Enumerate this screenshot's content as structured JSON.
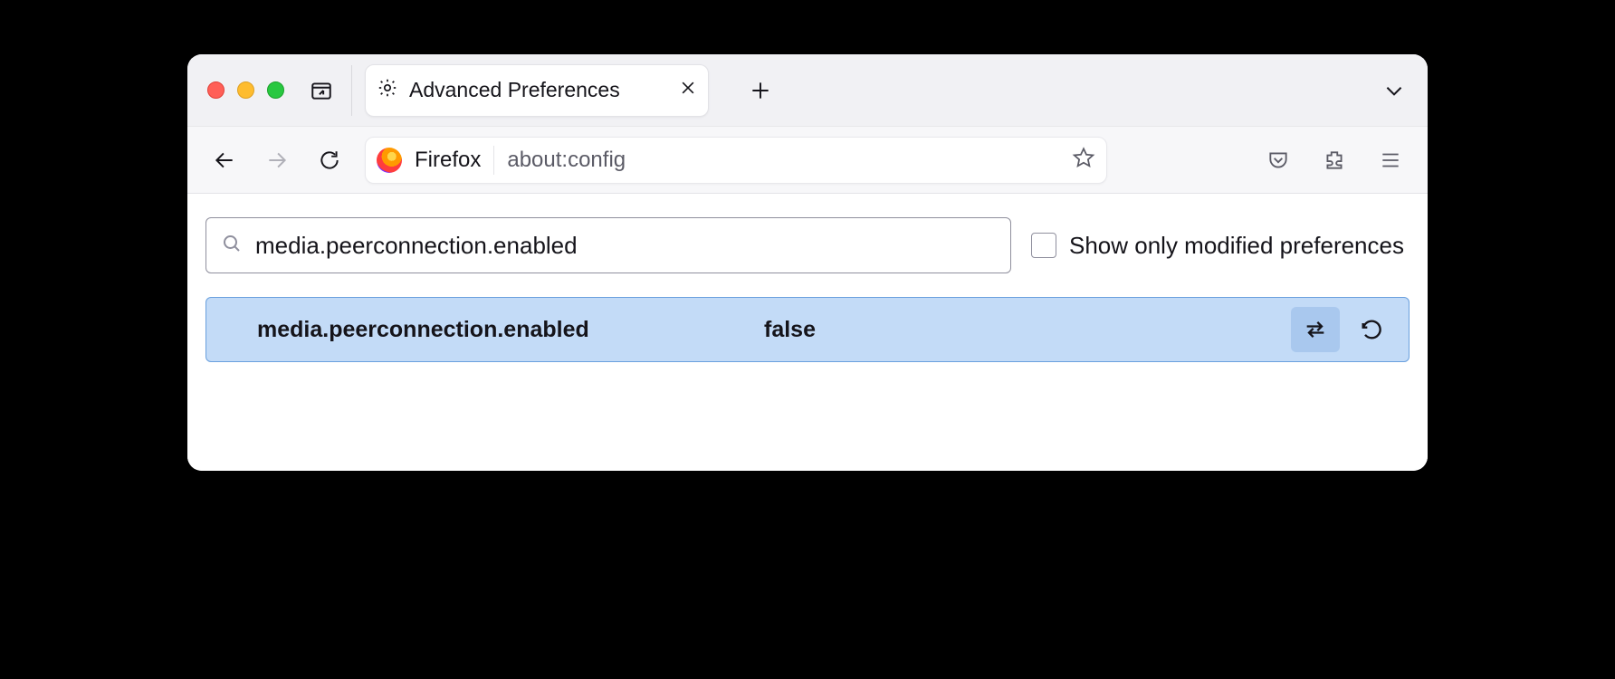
{
  "tab": {
    "title": "Advanced Preferences"
  },
  "urlbar": {
    "brand": "Firefox",
    "address": "about:config"
  },
  "search": {
    "value": "media.peerconnection.enabled"
  },
  "filter": {
    "label": "Show only modified preferences",
    "checked": false
  },
  "pref": {
    "name": "media.peerconnection.enabled",
    "value": "false"
  }
}
